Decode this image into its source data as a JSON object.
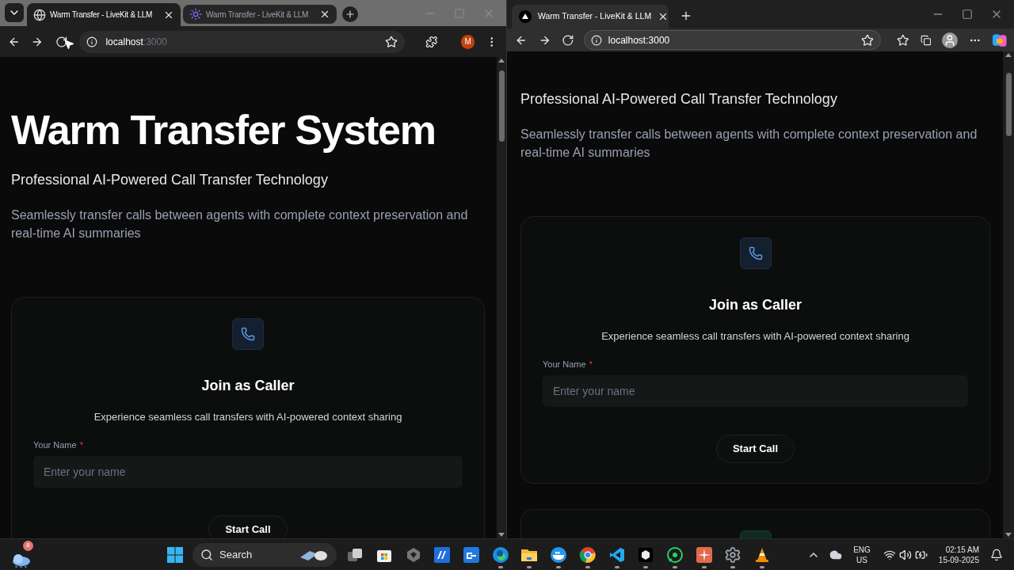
{
  "windows": [
    {
      "kind": "chrome",
      "tabs": [
        {
          "title": "Warm Transfer - LiveKit & LLM",
          "selected": true
        },
        {
          "title": "Warm Transfer - LiveKit & LLM",
          "selected": false
        }
      ],
      "url": {
        "host": "localhost",
        "port": ":3000"
      },
      "profile": "M",
      "page": {
        "title": "Warm Transfer System",
        "subtitle": "Professional AI-Powered Call Transfer Technology",
        "description": "Seamlessly transfer calls between agents with complete context preservation and real-time AI summaries",
        "card": {
          "heading": "Join as Caller",
          "text": "Experience seamless call transfers with AI-powered context sharing",
          "label": "Your Name",
          "required": "*",
          "placeholder": "Enter your name",
          "button": "Start Call"
        }
      }
    },
    {
      "kind": "edge",
      "tabs": [
        {
          "title": "Warm Transfer - LiveKit & LLM",
          "selected": true
        }
      ],
      "url": {
        "host": "localhost",
        "port": ":3000"
      },
      "page": {
        "subtitle": "Professional AI-Powered Call Transfer Technology",
        "description": "Seamlessly transfer calls between agents with complete context preservation and real-time AI summaries",
        "card": {
          "heading": "Join as Caller",
          "text": "Experience seamless call transfers with AI-powered context sharing",
          "label": "Your Name",
          "required": "*",
          "placeholder": "Enter your name",
          "button": "Start Call"
        }
      }
    }
  ],
  "taskbar": {
    "widgets_badge": "8",
    "search": "Search",
    "apps": [
      {
        "kind": "taskview",
        "running": false
      },
      {
        "kind": "store",
        "running": false
      },
      {
        "kind": "gem",
        "running": false
      },
      {
        "kind": "m",
        "running": false
      },
      {
        "kind": "link",
        "running": false
      },
      {
        "kind": "edge",
        "running": true
      },
      {
        "kind": "folder",
        "running": true
      },
      {
        "kind": "docker",
        "running": true
      },
      {
        "kind": "chrome",
        "running": true
      },
      {
        "kind": "vscode",
        "running": true
      },
      {
        "kind": "box",
        "running": true
      },
      {
        "kind": "whatsapp",
        "running": true
      },
      {
        "kind": "burst",
        "running": true
      },
      {
        "kind": "gear",
        "running": true
      },
      {
        "kind": "vlc",
        "running": true
      }
    ],
    "tray": {
      "lang": "ENG",
      "region": "US",
      "time": "02:15 AM",
      "date": "15-09-2025"
    }
  }
}
